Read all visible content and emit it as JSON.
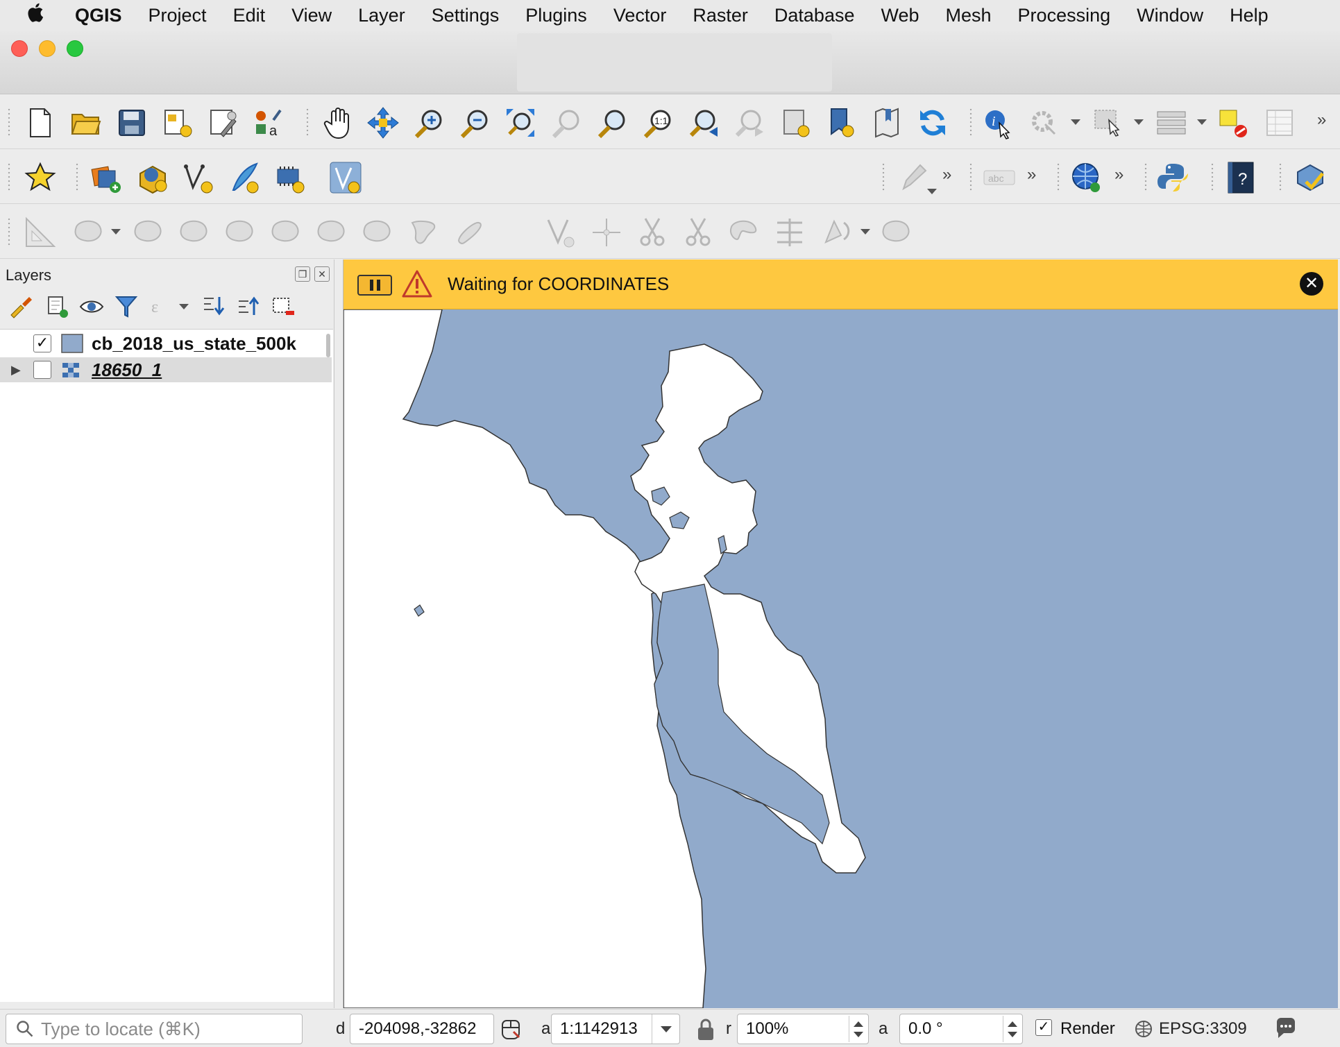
{
  "menubar": {
    "app": "QGIS",
    "items": [
      "Project",
      "Edit",
      "View",
      "Layer",
      "Settings",
      "Plugins",
      "Vector",
      "Raster",
      "Database",
      "Web",
      "Mesh",
      "Processing",
      "Window",
      "Help"
    ]
  },
  "toolbars": {
    "row1": [
      "new-project-icon",
      "open-project-icon",
      "save-project-icon",
      "layout-manager-icon",
      "style-manager-icon",
      "label-style-icon",
      "pan-icon",
      "pan-to-selection-icon",
      "zoom-in-icon",
      "zoom-out-icon",
      "zoom-full-icon",
      "zoom-to-selection-icon",
      "zoom-to-layer-icon",
      "zoom-native-icon",
      "zoom-last-icon",
      "zoom-next-icon",
      "new-map-view-icon",
      "new-bookmark-icon",
      "show-bookmarks-icon",
      "refresh-icon",
      "identify-icon",
      "run-action-icon",
      "select-features-icon",
      "attribute-table-toolbar-icon",
      "deselect-icon",
      "open-attribute-table-icon"
    ],
    "row2": [
      "qms-plugin-icon",
      "add-layer-icon",
      "add-wms-icon",
      "add-vector-icon",
      "add-feature-icon",
      "add-raster-icon",
      "vertex-tool-icon",
      "pencil-icon",
      "label-abc-icon",
      "globe-add-icon",
      "python-icon",
      "help-icon",
      "processing-check-icon"
    ],
    "row3": [
      "digitize-measure-icon",
      "add-ring-icon",
      "fill-ring-icon",
      "delete-ring-icon",
      "delete-part-icon",
      "reshape-icon",
      "offset-curve-icon",
      "split-features-icon",
      "split-parts-icon",
      "merge-icon",
      "rotate-icon",
      "simplify-icon",
      "trim-extend-icon"
    ]
  },
  "layers_panel": {
    "title": "Layers",
    "layers": [
      {
        "name": "cb_2018_us_state_500k",
        "checked": true,
        "type": "vector-polygon"
      },
      {
        "name": "18650_1",
        "checked": false,
        "type": "raster"
      }
    ]
  },
  "message_bar": {
    "text": "Waiting for COORDINATES"
  },
  "map": {
    "water_color": "#91aacb",
    "land_color": "#ffffff",
    "outline_color": "#333333"
  },
  "statusbar": {
    "locator_placeholder": "Type to locate (⌘K)",
    "coord_label": "d",
    "coordinate": "-204098,-32862",
    "scale_label": "a",
    "scale": "1:1142913",
    "magnifier_label": "r",
    "magnifier": "100%",
    "rotation_label": "a",
    "rotation": "0.0 °",
    "render_label": "Render",
    "render_checked": true,
    "crs": "EPSG:3309"
  }
}
